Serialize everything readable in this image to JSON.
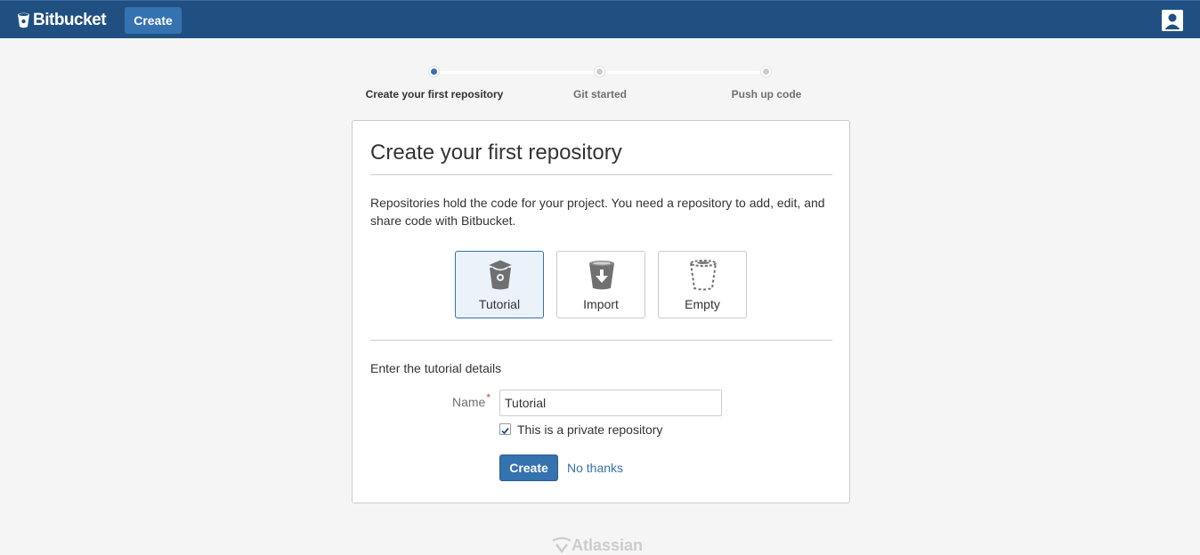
{
  "header": {
    "brand": "Bitbucket",
    "create_label": "Create",
    "bg_color": "#205081"
  },
  "stepper": {
    "steps": [
      {
        "label": "Create your first repository",
        "active": true
      },
      {
        "label": "Git started",
        "active": false
      },
      {
        "label": "Push up code",
        "active": false
      }
    ]
  },
  "card": {
    "title": "Create your first repository",
    "description": "Repositories hold the code for your project. You need a repository to add, edit, and share code with Bitbucket.",
    "options": [
      {
        "label": "Tutorial",
        "icon": "tutorial-bucket-icon",
        "selected": true
      },
      {
        "label": "Import",
        "icon": "import-bucket-icon",
        "selected": false
      },
      {
        "label": "Empty",
        "icon": "empty-bucket-icon",
        "selected": false
      }
    ],
    "section_label": "Enter the tutorial details",
    "form": {
      "name_label": "Name",
      "required_marker": "*",
      "name_value": "Tutorial",
      "private_label": "This is a private repository",
      "private_checked": true,
      "create_label": "Create",
      "no_thanks_label": "No thanks"
    }
  },
  "footer": {
    "brand": "Atlassian"
  }
}
